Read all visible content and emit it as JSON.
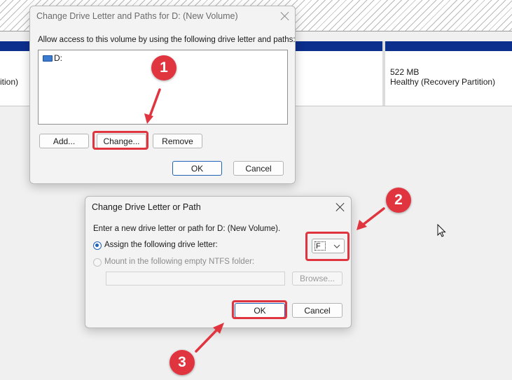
{
  "background": {
    "partition_left_text": "ition)",
    "partition_right_size": "522 MB",
    "partition_right_status": "Healthy (Recovery Partition)"
  },
  "dialog1": {
    "title": "Change Drive Letter and Paths for D: (New Volume)",
    "instruction": "Allow access to this volume by using the following drive letter and paths:",
    "list_items": [
      "D:"
    ],
    "add_label": "Add...",
    "change_label": "Change...",
    "remove_label": "Remove",
    "ok_label": "OK",
    "cancel_label": "Cancel"
  },
  "dialog2": {
    "title": "Change Drive Letter or Path",
    "instruction": "Enter a new drive letter or path for D: (New Volume).",
    "assign_label": "Assign the following drive letter:",
    "mount_label": "Mount in the following empty NTFS folder:",
    "drive_letter": "F",
    "browse_label": "Browse...",
    "ok_label": "OK",
    "cancel_label": "Cancel"
  },
  "annotations": {
    "steps": [
      "1",
      "2",
      "3"
    ],
    "color": "#e0343f"
  },
  "icons": {
    "drive": "drive-icon",
    "close": "close-icon",
    "dropdown": "chevron-down-icon",
    "cursor": "mouse-cursor-icon"
  }
}
